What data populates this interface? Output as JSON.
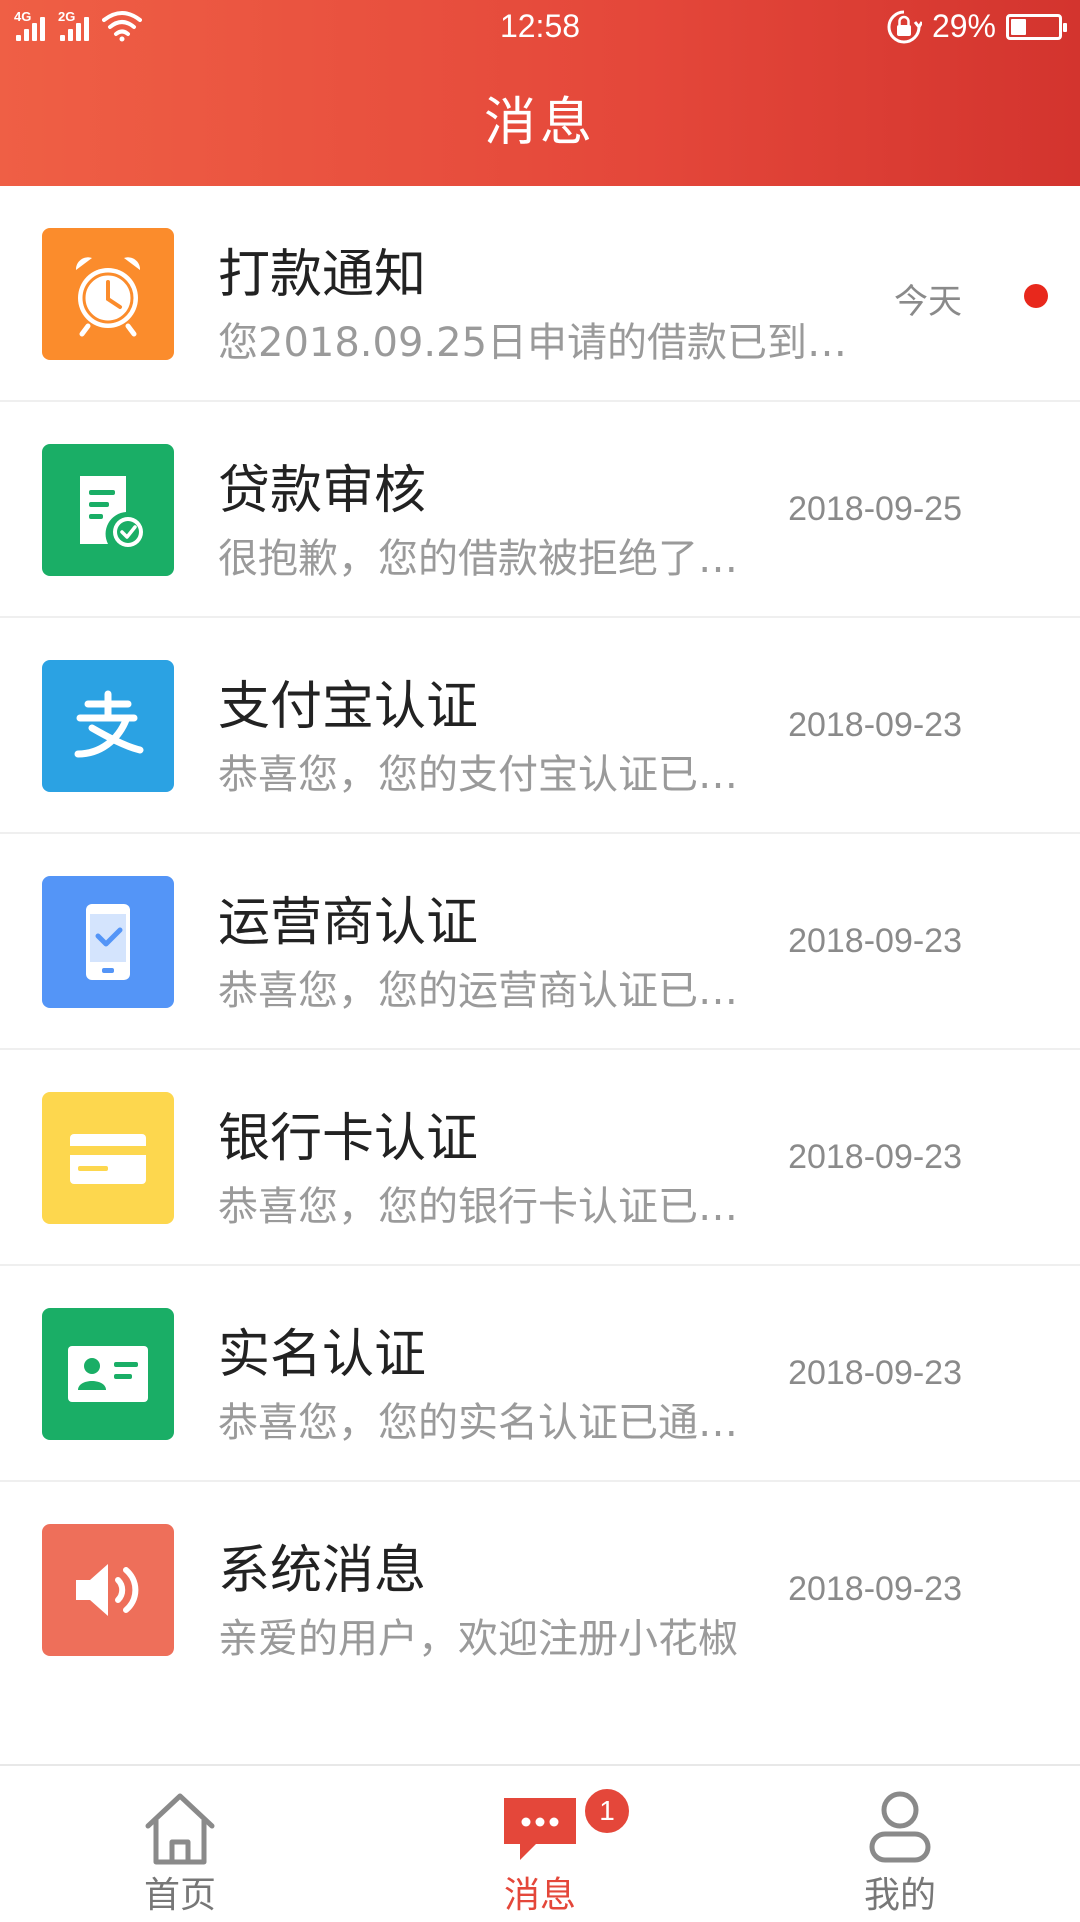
{
  "status_bar": {
    "network_1": "4G",
    "network_2": "2G",
    "time": "12:58",
    "battery_percent": "29%",
    "battery_level": 0.29
  },
  "header": {
    "title": "消息"
  },
  "messages": [
    {
      "title": "打款通知",
      "preview": "您2018.09.25日申请的借款已到账…",
      "date": "今天",
      "unread": true,
      "icon": "alarm-clock-icon",
      "color": "#fb8c2c"
    },
    {
      "title": "贷款审核",
      "preview": "很抱歉，您的借款被拒绝了…",
      "date": "2018-09-25",
      "unread": false,
      "icon": "document-check-icon",
      "color": "#1aae66"
    },
    {
      "title": "支付宝认证",
      "preview": "恭喜您，您的支付宝认证已…",
      "date": "2018-09-23",
      "unread": false,
      "icon": "alipay-icon",
      "color": "#2ba2e3"
    },
    {
      "title": "运营商认证",
      "preview": "恭喜您，您的运营商认证已…",
      "date": "2018-09-23",
      "unread": false,
      "icon": "phone-check-icon",
      "color": "#5495f7"
    },
    {
      "title": "银行卡认证",
      "preview": "恭喜您，您的银行卡认证已…",
      "date": "2018-09-23",
      "unread": false,
      "icon": "bank-card-icon",
      "color": "#fdd74e"
    },
    {
      "title": "实名认证",
      "preview": "恭喜您，您的实名认证已通…",
      "date": "2018-09-23",
      "unread": false,
      "icon": "id-card-icon",
      "color": "#1aae66"
    },
    {
      "title": "系统消息",
      "preview": "亲爱的用户，欢迎注册小花椒",
      "date": "2018-09-23",
      "unread": false,
      "icon": "speaker-icon",
      "color": "#ee6f5a"
    }
  ],
  "tabs": [
    {
      "label": "首页",
      "icon": "home-icon",
      "active": false
    },
    {
      "label": "消息",
      "icon": "chat-bubble-icon",
      "active": true,
      "badge": "1"
    },
    {
      "label": "我的",
      "icon": "user-icon",
      "active": false
    }
  ],
  "colors": {
    "header_start": "#ef5f45",
    "header_end": "#d3342e",
    "accent": "#e4473a",
    "unread_dot": "#e8281c"
  }
}
